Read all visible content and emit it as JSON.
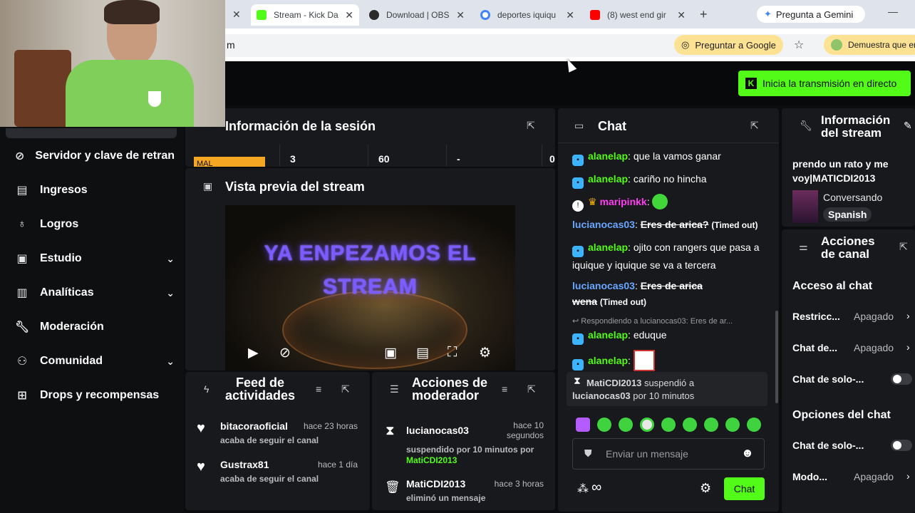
{
  "browser": {
    "tabs": [
      {
        "label": "Stream - Kick Da",
        "active": true
      },
      {
        "label": "Download | OBS"
      },
      {
        "label": "deportes iquiqu"
      },
      {
        "label": "(8) west end gir"
      }
    ],
    "new_tab": "+",
    "gemini": "Pregunta a Gemini",
    "address_fragment": "m",
    "ask_google": "Preguntar a Google",
    "promo": "Demuestra que er"
  },
  "header": {
    "go_live": "Inicia la transmisión en directo"
  },
  "sidebar": {
    "items": [
      {
        "label": "Servidor y clave de retran",
        "icon": "link-icon"
      },
      {
        "label": "Ingresos",
        "icon": "chart-icon"
      },
      {
        "label": "Logros",
        "icon": "trophy-icon"
      },
      {
        "label": "Estudio",
        "icon": "film-icon",
        "chevron": "⌄"
      },
      {
        "label": "Analíticas",
        "icon": "analytics-icon",
        "chevron": "⌄"
      },
      {
        "label": "Moderación",
        "icon": "wrench-icon"
      },
      {
        "label": "Comunidad",
        "icon": "users-icon",
        "chevron": "⌄"
      },
      {
        "label": "Drops y recompensas",
        "icon": "gift-icon"
      }
    ]
  },
  "session": {
    "title": "Información de la sesión",
    "cells": [
      "MAL",
      "3",
      "60",
      "-",
      "0"
    ]
  },
  "preview": {
    "title": "Vista previa del stream",
    "overlay_line1": "YA ENPEZAMOS EL",
    "overlay_line2": "STREAM"
  },
  "feed": {
    "title_line1": "Feed de",
    "title_line2": "actividades",
    "items": [
      {
        "name": "bitacoraoficial",
        "time": "hace 23 horas",
        "sub": "acaba de seguir el canal"
      },
      {
        "name": "Gustrax81",
        "time": "hace 1 día",
        "sub": "acaba de seguir el canal"
      }
    ]
  },
  "modactions": {
    "title_line1": "Acciones de",
    "title_line2": "moderador",
    "items": [
      {
        "name": "lucianocas03",
        "time_line1": "hace 10",
        "time_line2": "segundos",
        "sub": "suspendido por 10 minutos por",
        "by": "MatiCDI2013"
      },
      {
        "name": "MatiCDI2013",
        "time": "hace 3 horas",
        "sub": "eliminó un mensaje"
      }
    ]
  },
  "chat": {
    "title": "Chat",
    "messages": [
      {
        "user": "alanelap",
        "text": "que la vamos ganar"
      },
      {
        "user": "alanelap",
        "text": "cariño no hincha"
      },
      {
        "user": "maripinkk",
        "text": ""
      },
      {
        "user": "lucianocas03",
        "text": "Eres de arica?",
        "note": "(Timed out)"
      },
      {
        "user": "alanelap",
        "text": "ojito con rangers que pasa a iquique y iquique se va a tercera"
      },
      {
        "user": "lucianocas03",
        "text": "Eres de arica wena",
        "note": "(Timed out)"
      },
      {
        "reply": "Respondiendo a lucianocas03: Eres de ar...",
        "user": "alanelap",
        "text": "eduque"
      },
      {
        "user": "alanelap",
        "text": ""
      }
    ],
    "system": {
      "actor": "MatiCDI2013",
      "action": "suspendió a",
      "target": "lucianocas03",
      "rest": "por 10 minutos"
    },
    "input_placeholder": "Enviar un mensaje",
    "send": "Chat",
    "infinity": "∞"
  },
  "stream_info": {
    "title_line1": "Información",
    "title_line2": "del stream",
    "stream_title": "prendo un rato y me voy|MATICDI2013",
    "category": "Conversando",
    "language": "Spanish"
  },
  "channel_actions": {
    "title_line1": "Acciones",
    "title_line2": "de canal",
    "chat_access": "Acceso al chat",
    "rows": [
      {
        "label": "Restricc...",
        "value": "Apagado"
      },
      {
        "label": "Chat de...",
        "value": "Apagado"
      },
      {
        "label": "Chat de solo-..."
      }
    ],
    "chat_options": "Opciones del chat",
    "rows2": [
      {
        "label": "Chat de solo-..."
      },
      {
        "label": "Modo...",
        "value": "Apagado"
      }
    ]
  },
  "colors": {
    "accent": "#53fc18",
    "panel": "#18191c",
    "bg": "#0b0c0e"
  }
}
